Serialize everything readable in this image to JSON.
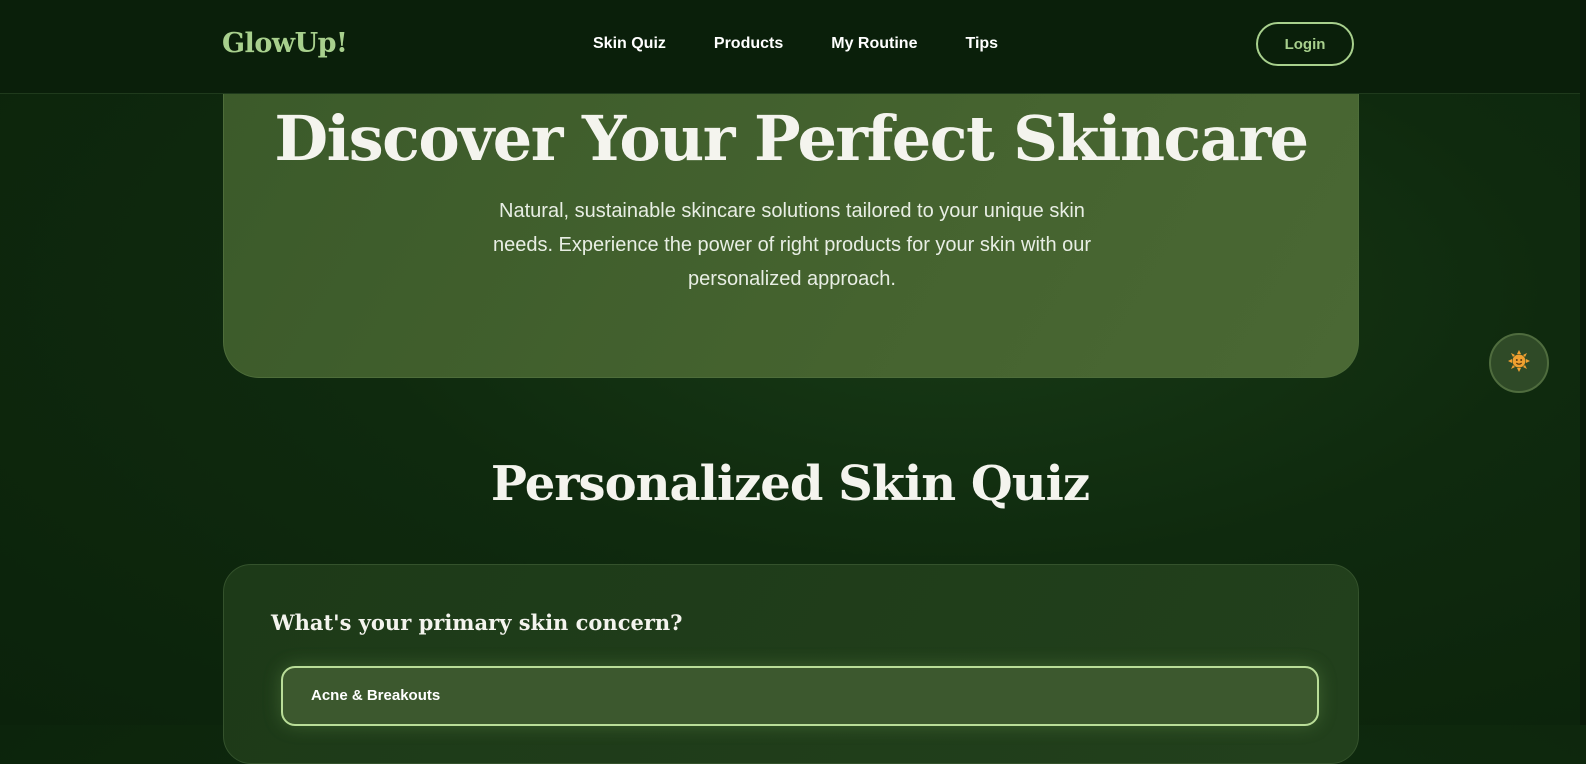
{
  "brand": {
    "logo": "GlowUp!"
  },
  "nav": {
    "items": [
      {
        "label": "Skin Quiz"
      },
      {
        "label": "Products"
      },
      {
        "label": "My Routine"
      },
      {
        "label": "Tips"
      }
    ],
    "login_label": "Login"
  },
  "hero": {
    "title": "Discover Your Perfect Skincare",
    "subtitle": "Natural, sustainable skincare solutions tailored to your unique skin needs. Experience the power of right products for your skin with our personalized approach."
  },
  "quiz": {
    "section_title": "Personalized Skin Quiz",
    "question": "What's your primary skin concern?",
    "options": [
      {
        "label": "Acne & Breakouts"
      }
    ]
  },
  "floating_button": {
    "icon": "sun-face-icon"
  },
  "colors": {
    "background": "#0f2a0e",
    "navbar": "#0a1f0a",
    "accent": "#a8d08d",
    "hero": "#45632f",
    "card": "#1f3d1a",
    "option_border": "#b9dd98"
  }
}
